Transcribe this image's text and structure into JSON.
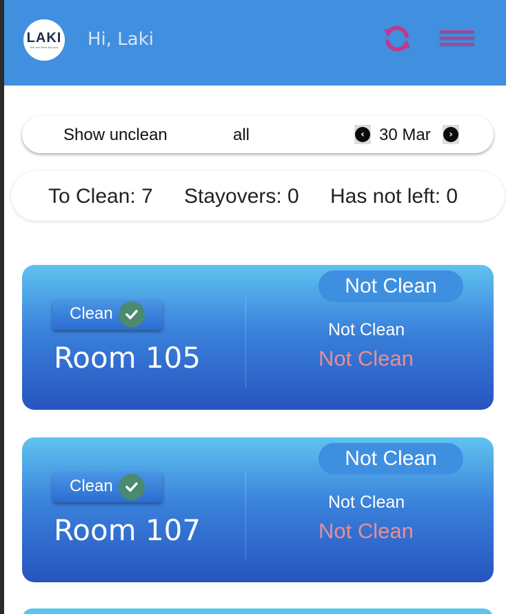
{
  "header": {
    "logo_text": "LAKI",
    "logo_tagline": "We are here for you",
    "greeting": "Hi, Laki",
    "refresh_icon": "refresh-icon",
    "menu_icon": "hamburger-menu-icon",
    "colors": {
      "background": "#418fdf",
      "accent": "#c0398f"
    }
  },
  "filter": {
    "show_label": "Show unclean",
    "scope_label": "all",
    "date": "30 Mar",
    "prev_icon": "chevron-left-icon",
    "next_icon": "chevron-right-icon"
  },
  "stats": {
    "to_clean": "To Clean: 7",
    "stayovers": "Stayovers: 0",
    "has_not_left": "Has not left: 0"
  },
  "rooms": [
    {
      "clean_button": "Clean",
      "room_name": "Room 105",
      "status_pill": "Not Clean",
      "status_line1": "Not Clean",
      "status_line2": "Not Clean"
    },
    {
      "clean_button": "Clean",
      "room_name": "Room 107",
      "status_pill": "Not Clean",
      "status_line1": "Not Clean",
      "status_line2": "Not Clean"
    }
  ]
}
